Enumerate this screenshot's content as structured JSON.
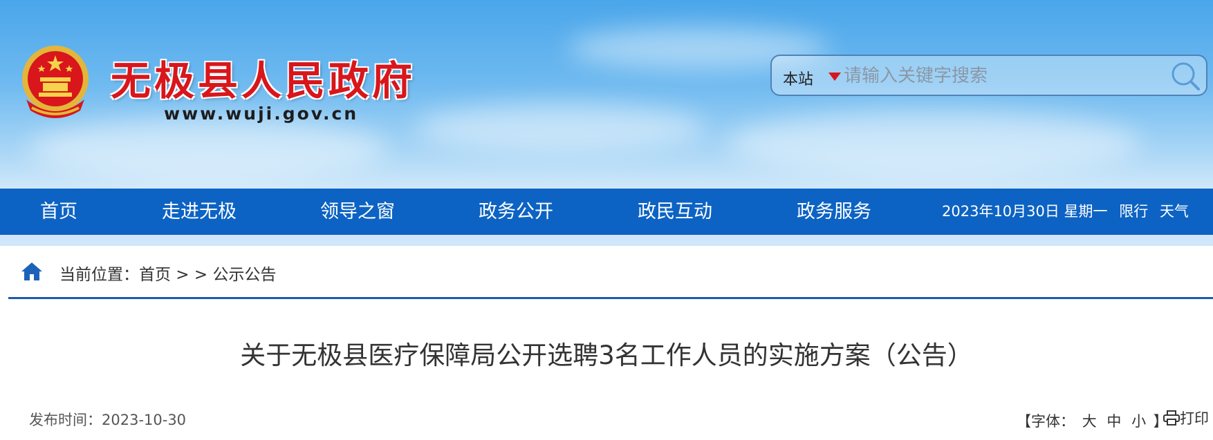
{
  "header": {
    "site_title": "无极县人民政府",
    "site_url": "www.wuji.gov.cn",
    "search_scope": "本站",
    "search_placeholder": "请输入关键字搜索"
  },
  "nav": {
    "items": [
      "首页",
      "走进无极",
      "领导之窗",
      "政务公开",
      "政民互动",
      "政务服务"
    ],
    "date": "2023年10月30日 星期一",
    "limit_label": "限行",
    "weather_label": "天气"
  },
  "breadcrumb": {
    "prefix": "当前位置：",
    "home": "首页",
    "separator": " > > ",
    "current": "公示公告"
  },
  "article": {
    "title": "关于无极县医疗保障局公开选聘3名工作人员的实施方案（公告）",
    "date_label": "发布时间：2023-10-30",
    "font_label_open": "【字体：",
    "font_large": "大",
    "font_medium": "中",
    "font_small": "小",
    "font_label_close": "】",
    "print_label": "打印"
  },
  "colors": {
    "nav_bg": "#0d63c3",
    "title_red": "#d8161b",
    "rule_blue": "#1e5ba8"
  },
  "icons": [
    "national-emblem-icon",
    "search-icon",
    "home-icon",
    "printer-icon",
    "dropdown-caret-icon"
  ]
}
